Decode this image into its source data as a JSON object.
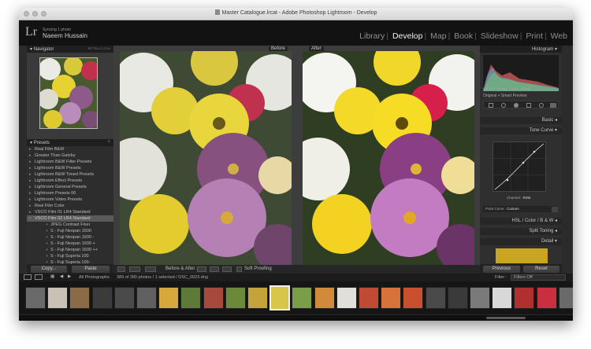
{
  "window": {
    "title": "Master Catalogue.lrcat - Adobe Photoshop Lightroom - Develop"
  },
  "identity": {
    "logo": "Lr",
    "sync": "Syncing 1 photo",
    "name": "Naeem Hussain"
  },
  "modules": [
    "Library",
    "Develop",
    "Map",
    "Book",
    "Slideshow",
    "Print",
    "Web"
  ],
  "active_module": "Develop",
  "left": {
    "navigator": "Navigator",
    "navigator_zoom": "FIT FILL 1:1 3:1",
    "presets_title": "Presets",
    "presets": [
      {
        "label": "Real Film B&W",
        "type": "closed"
      },
      {
        "label": "Greater Than Gatsby",
        "type": "closed"
      },
      {
        "label": "Lightroom B&W Filter Presets",
        "type": "closed"
      },
      {
        "label": "Lightroom B&W Presets",
        "type": "closed"
      },
      {
        "label": "Lightroom B&W Toned Presets",
        "type": "closed"
      },
      {
        "label": "Lightroom Effect Presets",
        "type": "closed"
      },
      {
        "label": "Lightroom General Presets",
        "type": "closed"
      },
      {
        "label": "Lightroom Presets 06",
        "type": "closed"
      },
      {
        "label": "Lightroom Video Presets",
        "type": "closed"
      },
      {
        "label": "Real Film Color",
        "type": "closed"
      },
      {
        "label": "VSCO Film 01 LR4 Standard",
        "type": "closed"
      },
      {
        "label": "VSCO Film 02 LR4 Standard",
        "type": "open"
      },
      {
        "label": "JPEG Contrast Fixer",
        "type": "sub"
      },
      {
        "label": "S - Fuji Neopan 1600",
        "type": "sub"
      },
      {
        "label": "S - Fuji Neopan 1600 -",
        "type": "sub"
      },
      {
        "label": "S - Fuji Neopan 1600 +",
        "type": "sub"
      },
      {
        "label": "S - Fuji Neopan 1600 ++",
        "type": "sub"
      },
      {
        "label": "S - Fuji Superia 100",
        "type": "sub"
      },
      {
        "label": "S - Fuji Superia 100-",
        "type": "sub"
      },
      {
        "label": "S - Fuji Superia 100+",
        "type": "sub"
      }
    ],
    "copy_label": "Copy...",
    "paste_label": "Paste"
  },
  "center": {
    "before_label": "Before",
    "after_label": "After",
    "toolbar": {
      "before_after": "Before & After :",
      "soft_proofing": "Soft Proofing"
    }
  },
  "right": {
    "histogram": "Histogram",
    "hist_info": [
      "ISO 400",
      "35 mm",
      "f / 2.8",
      "1/8 sec"
    ],
    "original": "Original + Smart Preview",
    "sections": [
      "Basic",
      "Tone Curve",
      "HSL / Color / B & W",
      "Split Toning",
      "Detail"
    ],
    "channel_label": "Channel :",
    "channel_value": "RGB",
    "point_curve_label": "Point Curve :",
    "point_curve_value": "Custom",
    "previous_label": "Previous",
    "reset_label": "Reset"
  },
  "filmstrip": {
    "source": "All Photographs",
    "status": "389 of 390 photos / 1 selected / DSC_0023.dng",
    "filter_label": "Filter :",
    "filter_value": "Filters Off",
    "pages": [
      "1",
      "2"
    ]
  },
  "thumb_colors": [
    "#6a6a6a",
    "#c9c2b4",
    "#8a6b45",
    "#3b3b3b",
    "#4a4a4a",
    "#606060",
    "#d7a83b",
    "#5d7a38",
    "#a84a3b",
    "#6a8a3a",
    "#c6a23b",
    "#d7c64a",
    "#7b9c48",
    "#d18a3a",
    "#e0e0d8",
    "#c14a35",
    "#d7733a",
    "#c8502e",
    "#4a4a4a",
    "#3a3a3a",
    "#7a7a7a",
    "#d8d8d8",
    "#b03030",
    "#c83040",
    "#6a6a6a"
  ],
  "selected_thumb": 11
}
